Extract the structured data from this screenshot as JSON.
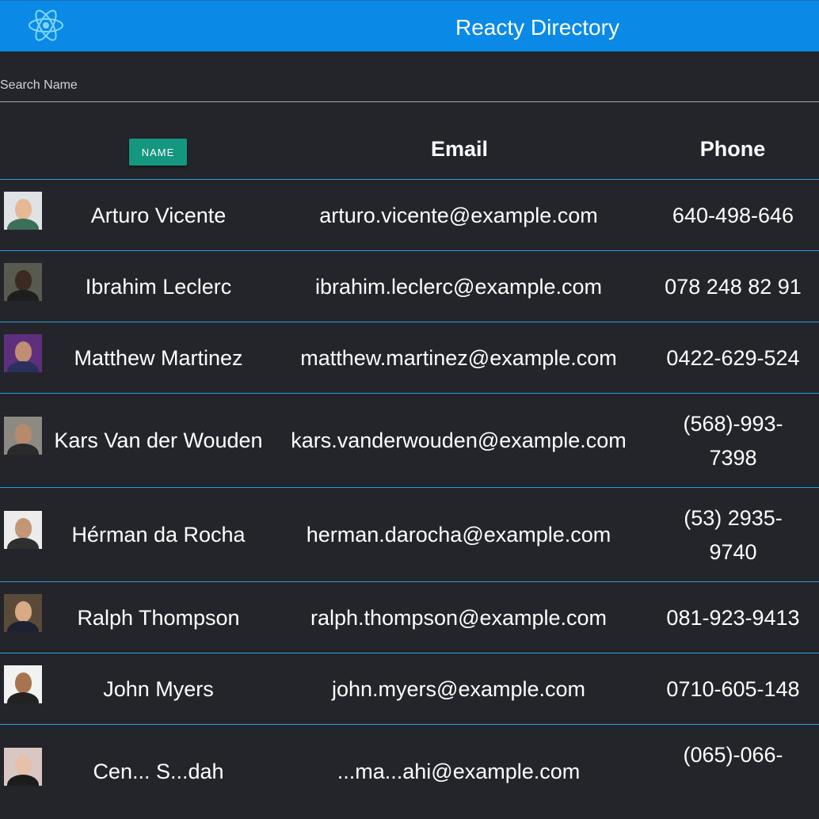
{
  "app": {
    "title": "Reacty Directory",
    "logo_icon": "react-atom-icon",
    "accent": "#0a8ae6"
  },
  "search": {
    "placeholder": "Search Name",
    "value": ""
  },
  "table": {
    "sort_button_label": "NAME",
    "header_email": "Email",
    "header_phone": "Phone",
    "row_divider_color": "#2aa0d8",
    "rows": [
      {
        "name": "Arturo Vicente",
        "email": "arturo.vicente@example.com",
        "phone": "640-498-646"
      },
      {
        "name": "Ibrahim Leclerc",
        "email": "ibrahim.leclerc@example.com",
        "phone": "078 248 82 91"
      },
      {
        "name": "Matthew Martinez",
        "email": "matthew.martinez@example.com",
        "phone": "0422-629-524"
      },
      {
        "name": "Kars Van der Wouden",
        "email": "kars.vanderwouden@example.com",
        "phone": "(568)-993-7398"
      },
      {
        "name": "Hérman da Rocha",
        "email": "herman.darocha@example.com",
        "phone": "(53) 2935-9740"
      },
      {
        "name": "Ralph Thompson",
        "email": "ralph.thompson@example.com",
        "phone": "081-923-9413"
      },
      {
        "name": "John Myers",
        "email": "john.myers@example.com",
        "phone": "0710-605-148"
      },
      {
        "name": "Cen... S...dah",
        "email": "...ma...ahi@example.com",
        "phone": "(065)-066-"
      }
    ]
  }
}
